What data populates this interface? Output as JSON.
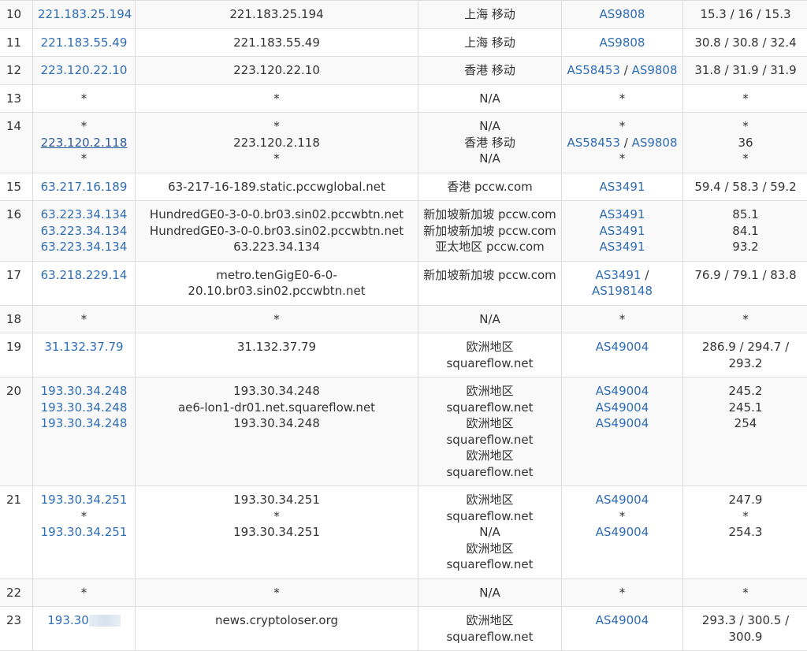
{
  "rows": [
    {
      "hop": "10",
      "ips": [
        "221.183.25.194"
      ],
      "hosts": [
        "221.183.25.194"
      ],
      "locs": [
        "上海 移动"
      ],
      "asns": [
        [
          "AS9808"
        ]
      ],
      "rtt": [
        "15.3 / 16 / 15.3"
      ]
    },
    {
      "hop": "11",
      "ips": [
        "221.183.55.49"
      ],
      "hosts": [
        "221.183.55.49"
      ],
      "locs": [
        "上海 移动"
      ],
      "asns": [
        [
          "AS9808"
        ]
      ],
      "rtt": [
        "30.8 / 30.8 / 32.4"
      ]
    },
    {
      "hop": "12",
      "ips": [
        "223.120.22.10"
      ],
      "hosts": [
        "223.120.22.10"
      ],
      "locs": [
        "香港 移动"
      ],
      "asns": [
        [
          "AS58453",
          "AS9808"
        ]
      ],
      "rtt": [
        "31.8 / 31.9 / 31.9"
      ]
    },
    {
      "hop": "13",
      "ips": [
        "*"
      ],
      "hosts": [
        "*"
      ],
      "locs": [
        "N/A"
      ],
      "asns": [
        [
          "*"
        ]
      ],
      "rtt": [
        "*"
      ]
    },
    {
      "hop": "14",
      "ips": [
        "*",
        "223.120.2.118",
        "*"
      ],
      "hosts": [
        "*",
        "223.120.2.118",
        "*"
      ],
      "locs": [
        "N/A",
        "香港 移动",
        "N/A"
      ],
      "asns": [
        [
          "*"
        ],
        [
          "AS58453",
          "AS9808"
        ],
        [
          "*"
        ]
      ],
      "rtt": [
        "*",
        "36",
        "*"
      ]
    },
    {
      "hop": "15",
      "ips": [
        "63.217.16.189"
      ],
      "hosts": [
        "63-217-16-189.static.pccwglobal.net"
      ],
      "locs": [
        "香港 pccw.com"
      ],
      "asns": [
        [
          "AS3491"
        ]
      ],
      "rtt": [
        "59.4 / 58.3 / 59.2"
      ]
    },
    {
      "hop": "16",
      "ips": [
        "63.223.34.134",
        "63.223.34.134",
        "63.223.34.134"
      ],
      "hosts": [
        "HundredGE0-3-0-0.br03.sin02.pccwbtn.net",
        "HundredGE0-3-0-0.br03.sin02.pccwbtn.net",
        "63.223.34.134"
      ],
      "locs": [
        "新加坡新加坡 pccw.com",
        "新加坡新加坡 pccw.com",
        "亚太地区 pccw.com"
      ],
      "asns": [
        [
          "AS3491"
        ],
        [
          "AS3491"
        ],
        [
          "AS3491"
        ]
      ],
      "rtt": [
        "85.1",
        "84.1",
        "93.2"
      ]
    },
    {
      "hop": "17",
      "ips": [
        "63.218.229.14"
      ],
      "hosts": [
        "metro.tenGigE0-6-0-",
        "20.10.br03.sin02.pccwbtn.net"
      ],
      "locs": [
        "新加坡新加坡 pccw.com"
      ],
      "asns": [
        [
          "AS3491",
          "AS198148"
        ]
      ],
      "rtt": [
        "76.9 / 79.1 / 83.8"
      ]
    },
    {
      "hop": "18",
      "ips": [
        "*"
      ],
      "hosts": [
        "*"
      ],
      "locs": [
        "N/A"
      ],
      "asns": [
        [
          "*"
        ]
      ],
      "rtt": [
        "*"
      ]
    },
    {
      "hop": "19",
      "ips": [
        "31.132.37.79"
      ],
      "hosts": [
        "31.132.37.79"
      ],
      "locs": [
        "欧洲地区 squareflow.net"
      ],
      "asns": [
        [
          "AS49004"
        ]
      ],
      "rtt": [
        "286.9 / 294.7 / 293.2"
      ]
    },
    {
      "hop": "20",
      "ips": [
        "193.30.34.248",
        "193.30.34.248",
        "193.30.34.248"
      ],
      "hosts": [
        "193.30.34.248",
        "ae6-lon1-dr01.net.squareflow.net",
        "193.30.34.248"
      ],
      "locs": [
        "欧洲地区 squareflow.net",
        "欧洲地区 squareflow.net",
        "欧洲地区 squareflow.net"
      ],
      "asns": [
        [
          "AS49004"
        ],
        [
          "AS49004"
        ],
        [
          "AS49004"
        ]
      ],
      "rtt": [
        "245.2",
        "245.1",
        "254"
      ]
    },
    {
      "hop": "21",
      "ips": [
        "193.30.34.251",
        "*",
        "193.30.34.251"
      ],
      "hosts": [
        "193.30.34.251",
        "*",
        "193.30.34.251"
      ],
      "locs": [
        "欧洲地区 squareflow.net",
        "N/A",
        "欧洲地区 squareflow.net"
      ],
      "asns": [
        [
          "AS49004"
        ],
        [
          "*"
        ],
        [
          "AS49004"
        ]
      ],
      "rtt": [
        "247.9",
        "*",
        "254.3"
      ]
    },
    {
      "hop": "22",
      "ips": [
        "*"
      ],
      "hosts": [
        "*"
      ],
      "locs": [
        "N/A"
      ],
      "asns": [
        [
          "*"
        ]
      ],
      "rtt": [
        "*"
      ]
    },
    {
      "hop": "23",
      "ips": [
        "193.30"
      ],
      "ip_redacted": true,
      "hosts": [
        "news.cryptoloser.org"
      ],
      "locs": [
        "欧洲地区 squareflow.net"
      ],
      "asns": [
        [
          "AS49004"
        ]
      ],
      "rtt": [
        "293.3 / 300.5 / 300.9"
      ]
    }
  ],
  "underlined_ip": "223.120.2.118",
  "colors": {
    "link": "#2f6db5",
    "border": "#dddddd",
    "stripe": "#f9f9f9",
    "text": "#333333"
  }
}
